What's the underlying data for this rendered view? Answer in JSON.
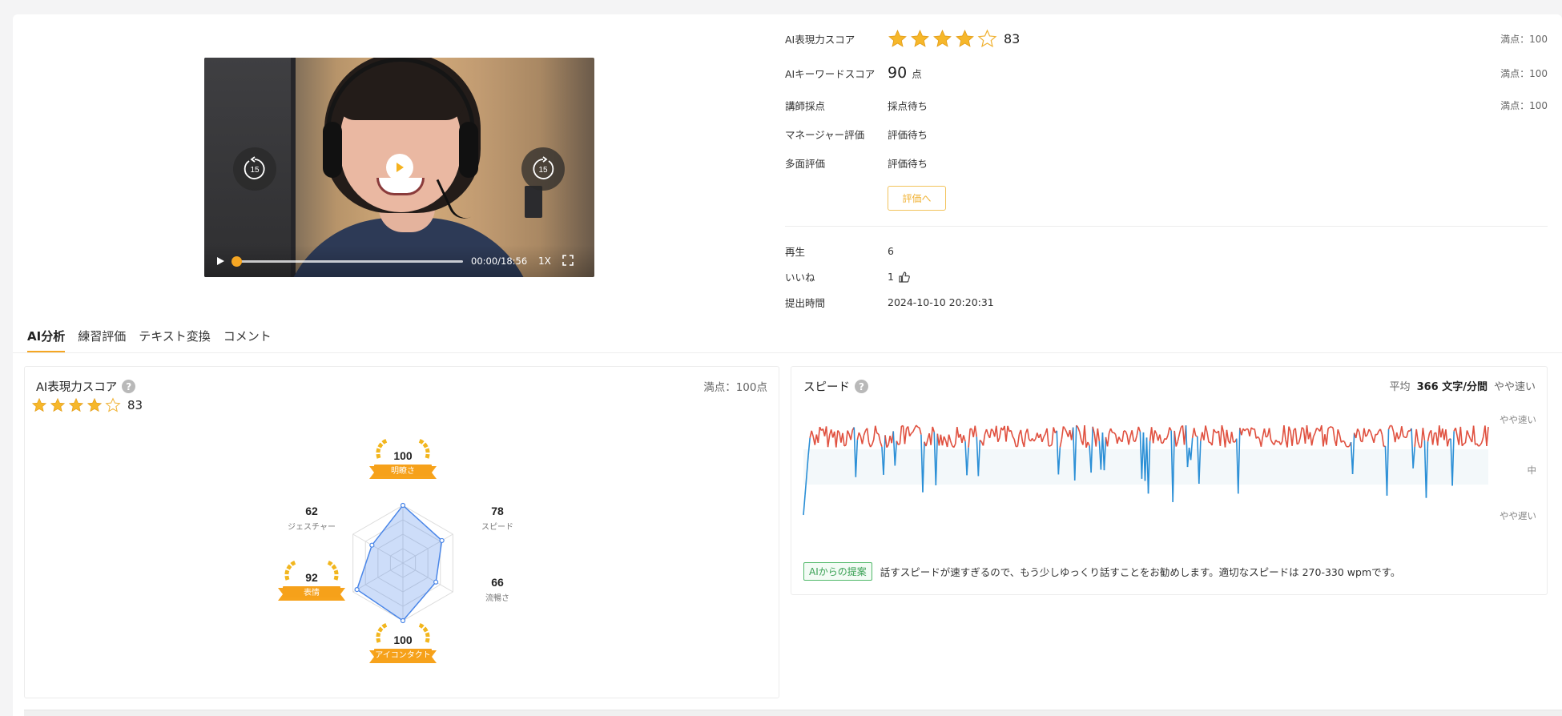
{
  "video": {
    "time": "00:00/18:56",
    "speed": "1X",
    "skip_back": "15",
    "skip_forward": "15",
    "progress_fraction": 0.0
  },
  "info": {
    "ai_expression": {
      "label": "AI表現力スコア",
      "stars": 4,
      "score": "83",
      "full": "満点：100"
    },
    "ai_keyword": {
      "label": "AIキーワードスコア",
      "score": "90",
      "unit": "点",
      "full": "満点：100"
    },
    "instructor": {
      "label": "講師採点",
      "value": "採点待ち",
      "full": "満点：100"
    },
    "manager": {
      "label": "マネージャー評価",
      "value": "評価待ち"
    },
    "multi": {
      "label": "多面評価",
      "value": "評価待ち"
    },
    "eval_button": "評価へ",
    "plays": {
      "label": "再生",
      "value": "6"
    },
    "likes": {
      "label": "いいね",
      "value": "1"
    },
    "submitted": {
      "label": "提出時間",
      "value": "2024-10-10 20:20:31"
    }
  },
  "tabs": [
    "AI分析",
    "練習評価",
    "テキスト変換",
    "コメント"
  ],
  "score_panel": {
    "title": "AI表現力スコア",
    "help": "?",
    "full": "満点：100点",
    "stars": 4,
    "score": "83"
  },
  "radar": {
    "axes": [
      {
        "name": "明瞭さ",
        "value": 100,
        "award": true
      },
      {
        "name": "スピード",
        "value": 78,
        "award": false
      },
      {
        "name": "流暢さ",
        "value": 66,
        "award": false
      },
      {
        "name": "アイコンタクト",
        "value": 100,
        "award": true
      },
      {
        "name": "表情",
        "value": 92,
        "award": true
      },
      {
        "name": "ジェスチャー",
        "value": 62,
        "award": false
      }
    ]
  },
  "speed_panel": {
    "title": "スピード",
    "help": "?",
    "avg_label": "平均",
    "avg_value": "366 文字/分間",
    "avg_level": "やや速い",
    "levels": [
      "やや速い",
      "中",
      "やや遅い"
    ],
    "suggest_tag": "AIからの提案",
    "suggest_text": "話すスピードが速すぎるので、もう少しゆっくり話すことをお勧めします。適切なスピードは 270-330 wpmです。"
  },
  "colors": {
    "accent": "#f5a623",
    "fast": "#e0503f",
    "slow": "#2b8fd6",
    "radar": "#4a86e8"
  }
}
